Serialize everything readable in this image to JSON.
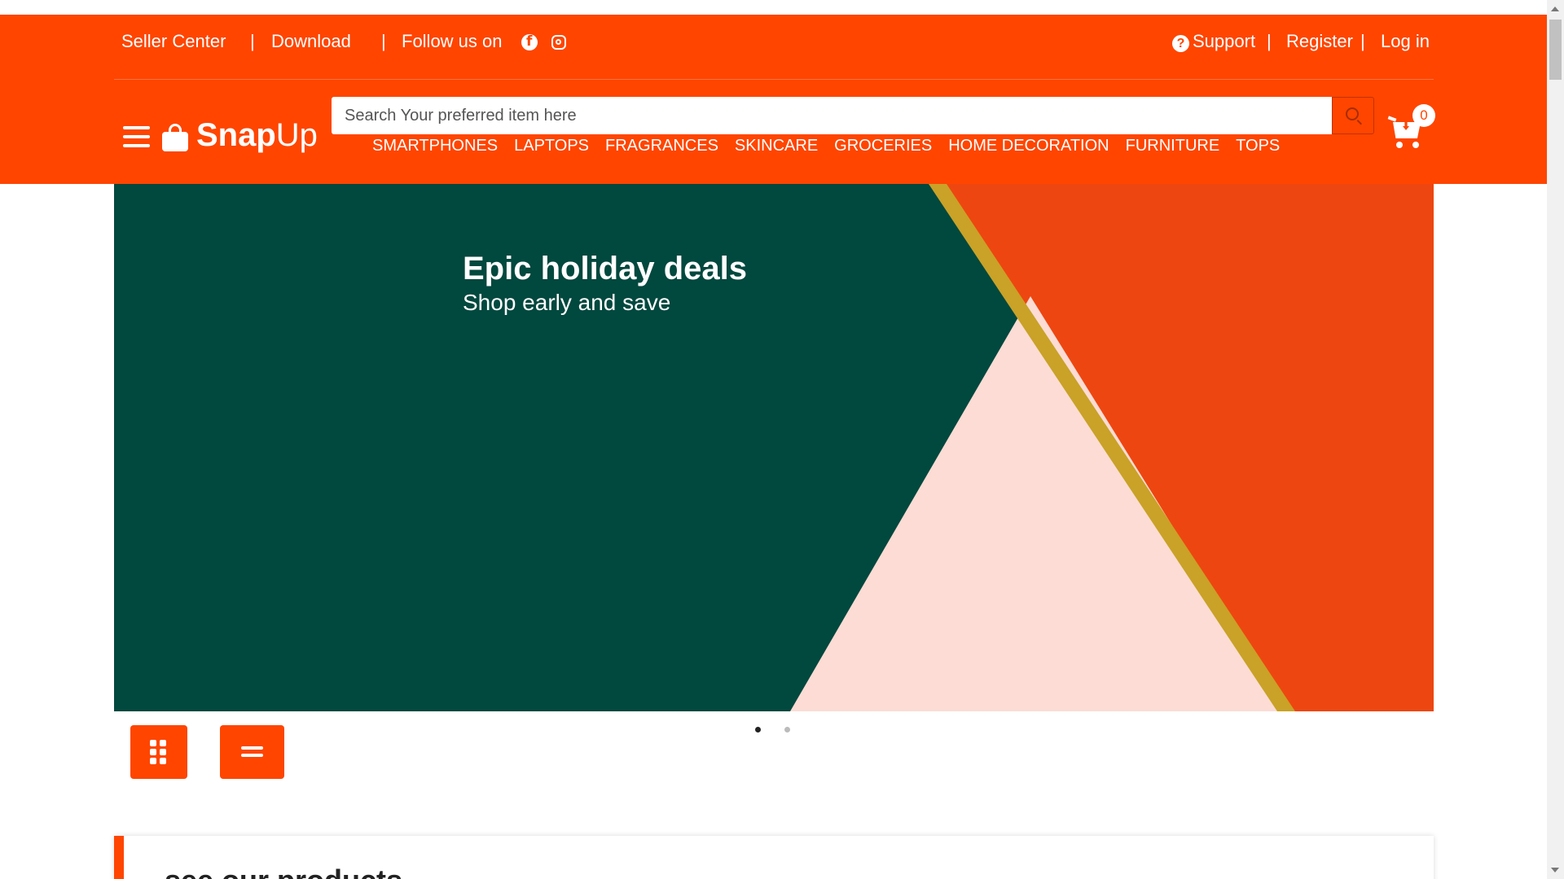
{
  "topbar": {
    "seller_center": "Seller Center",
    "download": "Download",
    "follow_us": "Follow us on",
    "separator": "|",
    "support": "Support",
    "register": "Register",
    "login": "Log in"
  },
  "brand": {
    "name_bold": "Snap",
    "name_light": "Up"
  },
  "search": {
    "placeholder": "Search Your preferred item here"
  },
  "categories": [
    "SMARTPHONES",
    "LAPTOPS",
    "FRAGRANCES",
    "SKINCARE",
    "GROCERIES",
    "HOME DECORATION",
    "FURNITURE",
    "TOPS"
  ],
  "cart": {
    "count": "0"
  },
  "hero": {
    "title": "Epic holiday deals",
    "subtitle": "Shop early and save",
    "slides_total": 2,
    "active_slide": 1
  },
  "products": {
    "heading": "see our products"
  },
  "colors": {
    "brand_orange": "#ff4500",
    "hero_green": "#01483e",
    "hero_pink": "#fcdcd4",
    "hero_gold": "#c9a227"
  }
}
